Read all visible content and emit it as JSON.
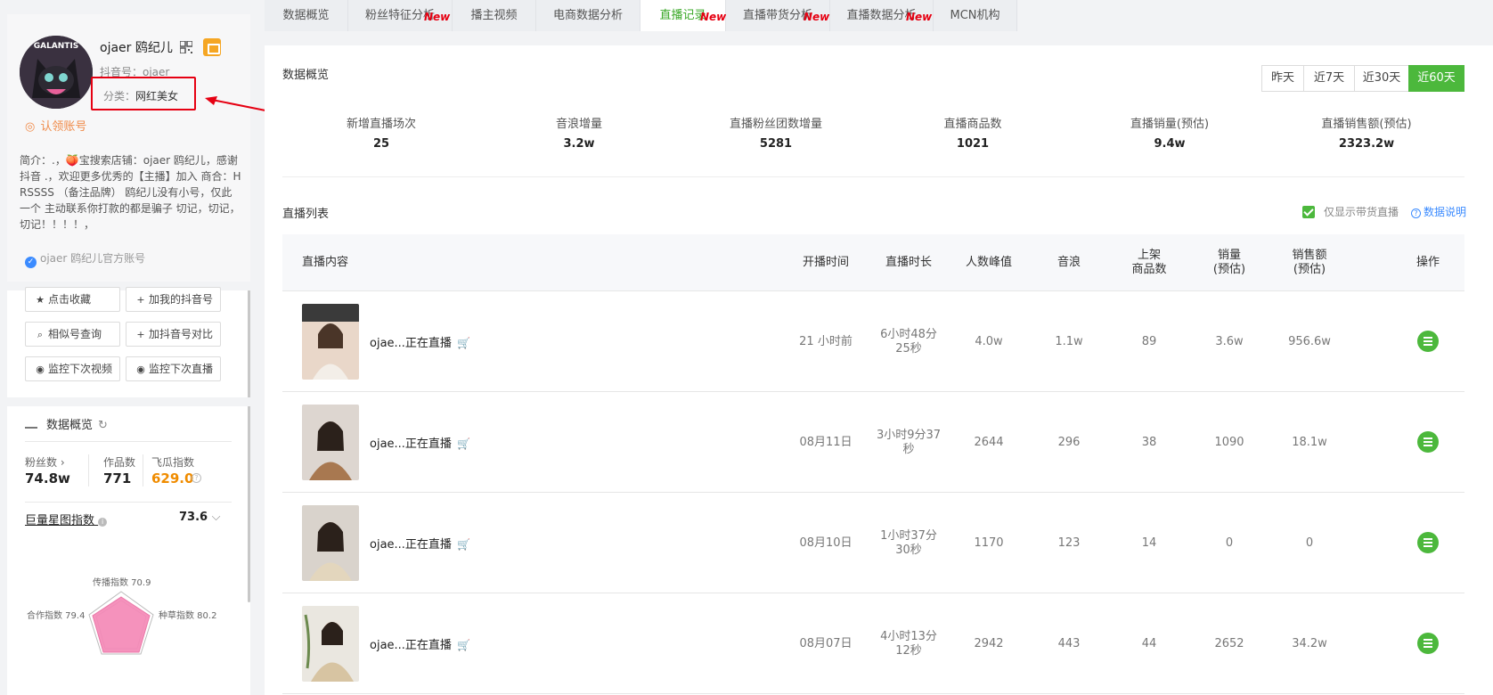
{
  "profile": {
    "name": "ojaer 鸥纪儿",
    "douyin_id": "抖音号：ojaer",
    "category_label": "分类：",
    "category_value": "网红美女",
    "verified": "认领账号",
    "avatar_text": "GALANTIS",
    "intro": "简介：.，🍑宝搜索店铺：ojaer 鸥纪儿，感谢抖音 .，欢迎更多优秀的【主播】加入 商合：HRSSSS （备注品牌） 鸥纪儿没有小号，仅此一个 主动联系你打款的都是骗子 切记，切记，切记！！！！，",
    "official": "ojaer 鸥纪儿官方账号"
  },
  "actions": [
    {
      "icon": "★",
      "label": "点击收藏"
    },
    {
      "icon": "+",
      "label": "加我的抖音号"
    },
    {
      "icon": "⌕",
      "label": "相似号查询"
    },
    {
      "icon": "+",
      "label": "加抖音号对比"
    },
    {
      "icon": "◉",
      "label": "监控下次视频"
    },
    {
      "icon": "◉",
      "label": "监控下次直播"
    }
  ],
  "overview": {
    "title": "数据概览",
    "fans_label": "粉丝数",
    "fans_value": "74.8w",
    "works_label": "作品数",
    "works_value": "771",
    "feigua_label": "飞瓜指数",
    "feigua_value": "629.0",
    "xingtu_label": "巨量星图指数",
    "xingtu_value": "73.6",
    "radar_spread": "传播指数 70.9",
    "radar_coop": "合作指数 79.4",
    "radar_grass": "种草指数 80.2"
  },
  "tabs": [
    {
      "label": "数据概览",
      "new": false,
      "active": false
    },
    {
      "label": "粉丝特征分析",
      "new": true,
      "active": false
    },
    {
      "label": "播主视频",
      "new": false,
      "active": false
    },
    {
      "label": "电商数据分析",
      "new": false,
      "active": false
    },
    {
      "label": "直播记录",
      "new": true,
      "active": true
    },
    {
      "label": "直播带货分析",
      "new": true,
      "active": false
    },
    {
      "label": "直播数据分析",
      "new": true,
      "active": false
    },
    {
      "label": "MCN机构",
      "new": false,
      "active": false
    }
  ],
  "new_badge": "New",
  "data_overview": {
    "title": "数据概览",
    "ranges": [
      "昨天",
      "近7天",
      "近30天",
      "近60天"
    ],
    "active_range": "近60天",
    "metrics": [
      {
        "label": "新增直播场次",
        "value": "25"
      },
      {
        "label": "音浪增量",
        "value": "3.2w"
      },
      {
        "label": "直播粉丝团数增量",
        "value": "5281"
      },
      {
        "label": "直播商品数",
        "value": "1021"
      },
      {
        "label": "直播销量(预估)",
        "value": "9.4w"
      },
      {
        "label": "直播销售额(预估)",
        "value": "2323.2w"
      }
    ]
  },
  "live_list": {
    "title": "直播列表",
    "only_goods": "仅显示带货直播",
    "help": "数据说明",
    "columns": [
      "直播内容",
      "开播时间",
      "直播时长",
      "人数峰值",
      "音浪",
      "上架\n商品数",
      "销量\n(预估)",
      "销售额\n(预估)",
      "操作"
    ],
    "rows": [
      {
        "title": "ojae...正在直播",
        "start": "21 小时前",
        "duration": "6小时48分\n25秒",
        "peak": "4.0w",
        "yinlang": "1.1w",
        "goods": "89",
        "sales": "3.6w",
        "amount": "956.6w"
      },
      {
        "title": "ojae...正在直播",
        "start": "08月11日",
        "duration": "3小时9分37\n秒",
        "peak": "2644",
        "yinlang": "296",
        "goods": "38",
        "sales": "1090",
        "amount": "18.1w"
      },
      {
        "title": "ojae...正在直播",
        "start": "08月10日",
        "duration": "1小时37分\n30秒",
        "peak": "1170",
        "yinlang": "123",
        "goods": "14",
        "sales": "0",
        "amount": "0"
      },
      {
        "title": "ojae...正在直播",
        "start": "08月07日",
        "duration": "4小时13分\n12秒",
        "peak": "2942",
        "yinlang": "443",
        "goods": "44",
        "sales": "2652",
        "amount": "34.2w"
      }
    ]
  },
  "colors": {
    "accent": "#4cb83c",
    "badge": "#e60012",
    "highlight": "#e60012"
  }
}
